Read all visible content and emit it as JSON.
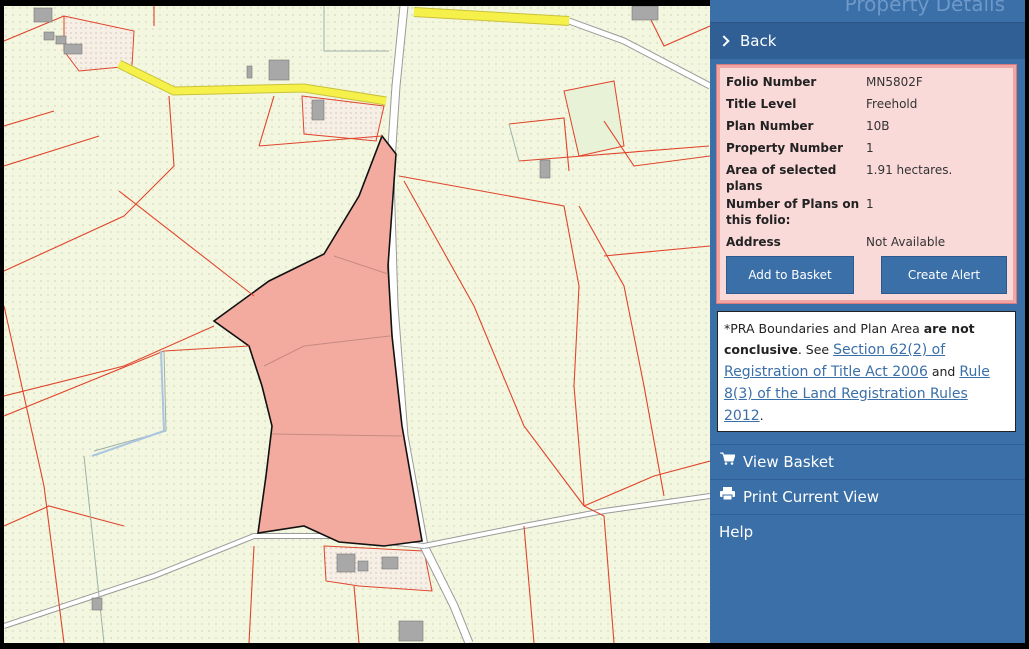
{
  "panel": {
    "title": "Property Details",
    "back_label": "Back",
    "details": [
      {
        "label": "Folio Number",
        "value": "MN5802F"
      },
      {
        "label": "Title Level",
        "value": "Freehold"
      },
      {
        "label": "Plan Number",
        "value": "10B"
      },
      {
        "label": "Property Number",
        "value": "1"
      },
      {
        "label": "Area of selected plans",
        "value": "1.91 hectares."
      },
      {
        "label": "Number of Plans on this folio:",
        "value": "1"
      },
      {
        "label": "Address",
        "value": "Not Available"
      }
    ],
    "add_to_basket_label": "Add to Basket",
    "create_alert_label": "Create Alert",
    "notice": {
      "prefix": "*PRA Boundaries and Plan Area ",
      "bold": "are not conclusive",
      "see": ". See ",
      "link1": "Section 62(2) of Registration of Title Act 2006",
      "and": " and ",
      "link2": "Rule 8(3) of the Land Registration Rules 2012",
      "end": "."
    },
    "menu": [
      {
        "icon": "cart-icon",
        "label": "View Basket"
      },
      {
        "icon": "printer-icon",
        "label": "Print Current View"
      },
      {
        "icon": "",
        "label": "Help"
      }
    ]
  },
  "colors": {
    "map_background": "#f3f7df",
    "parcel_highlight": "#f4ab9f",
    "boundary": "#e0442c",
    "road_major": "#f6f04a",
    "panel": "#3a6fa8",
    "details_background": "#fad9d9"
  }
}
